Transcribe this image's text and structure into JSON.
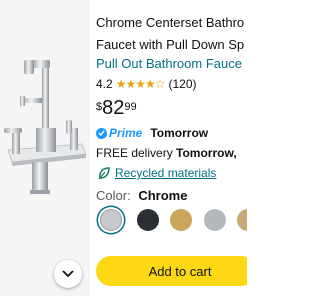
{
  "product": {
    "title_line1": "Chrome Centerset Bathro",
    "title_line2": "Faucet with Pull Down Sp",
    "subtitle": "Pull Out Bathroom Fauce",
    "rating": "4.2",
    "stars": "★★★★☆",
    "review_count": "(120)",
    "price": {
      "currency": "$",
      "whole": "82",
      "fraction": "99"
    }
  },
  "prime": {
    "label": "Prime",
    "delivery_label": "Tomorrow"
  },
  "delivery": {
    "free_text": "FREE delivery",
    "date": "Tomorrow,"
  },
  "recycled": {
    "label": "Recycled materials",
    "icon": "leaf-icon"
  },
  "color": {
    "label": "Color:",
    "selected": "Chrome",
    "swatches": [
      "#c7cacc",
      "#2b2f33",
      "#c9a65a",
      "#b5b8ba",
      "#c8a77a"
    ]
  },
  "actions": {
    "add_to_cart": "Add to cart",
    "scroll_icon": "chevron-down-icon"
  },
  "colors": {
    "link": "#007185",
    "prime_blue": "#1a98ff",
    "cart_yellow": "#ffd814",
    "star": "#e8a317"
  }
}
